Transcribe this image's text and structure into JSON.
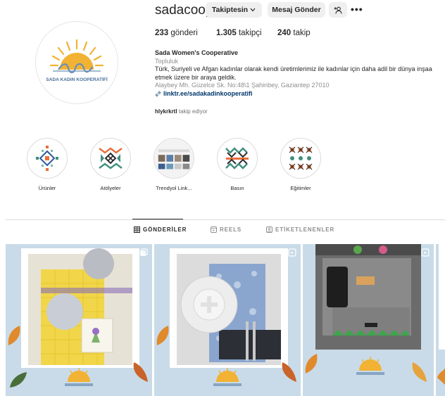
{
  "profile": {
    "username": "sadacoop",
    "follow_button": "Takiptesin",
    "message_button": "Mesaj Gönder",
    "stats": {
      "posts_count": "233",
      "posts_label": "gönderi",
      "followers_count": "1.305",
      "followers_label": "takipçi",
      "following_count": "240",
      "following_label": "takip"
    },
    "bio": {
      "name": "Sada Women's Cooperative",
      "category": "Topluluk",
      "line1": "Türk, Suriyeli ve Afgan kadınlar olarak kendi üretimlerimiz ile kadınlar için daha adil bir dünya inşaa",
      "line2": "etmek üzere bir araya geldik.",
      "address": "Alaybey Mh. Güzelce Sk. No:48\\1 Şahinbey, Gaziantep 27010",
      "link": "linktr.ee/sadakadinkooperatifi"
    },
    "followed_by": {
      "user": "hlykrkrtl",
      "text": "takip ediyor"
    },
    "avatar_logo_text": "SADA KADIN KOOPERATİFİ"
  },
  "highlights": [
    {
      "label": "Ürünler"
    },
    {
      "label": "Atölyeler"
    },
    {
      "label": "Trendyol Link..."
    },
    {
      "label": "Basın"
    },
    {
      "label": "Eğitimler"
    }
  ],
  "tabs": [
    {
      "label": "GÖNDERİLER",
      "icon": "grid-icon",
      "active": true
    },
    {
      "label": "REELS",
      "icon": "reels-icon",
      "active": false
    },
    {
      "label": "ETİKETLENENLER",
      "icon": "tagged-icon",
      "active": false
    }
  ],
  "posts": [
    {
      "alt": "yellow gingham table runner with grey placemat",
      "icon": "carousel-icon"
    },
    {
      "alt": "blue floral placemat with white plate",
      "icon": "reels-icon"
    },
    {
      "alt": "grey felt phone pouch with green trim",
      "icon": "reels-icon"
    },
    {
      "alt": "partial post",
      "icon": "reels-icon"
    }
  ],
  "colors": {
    "accent_link": "#00376b",
    "logo_sun": "#f2b233",
    "logo_blue": "#6b8fb5",
    "post_bg": "#c9dbe8"
  }
}
